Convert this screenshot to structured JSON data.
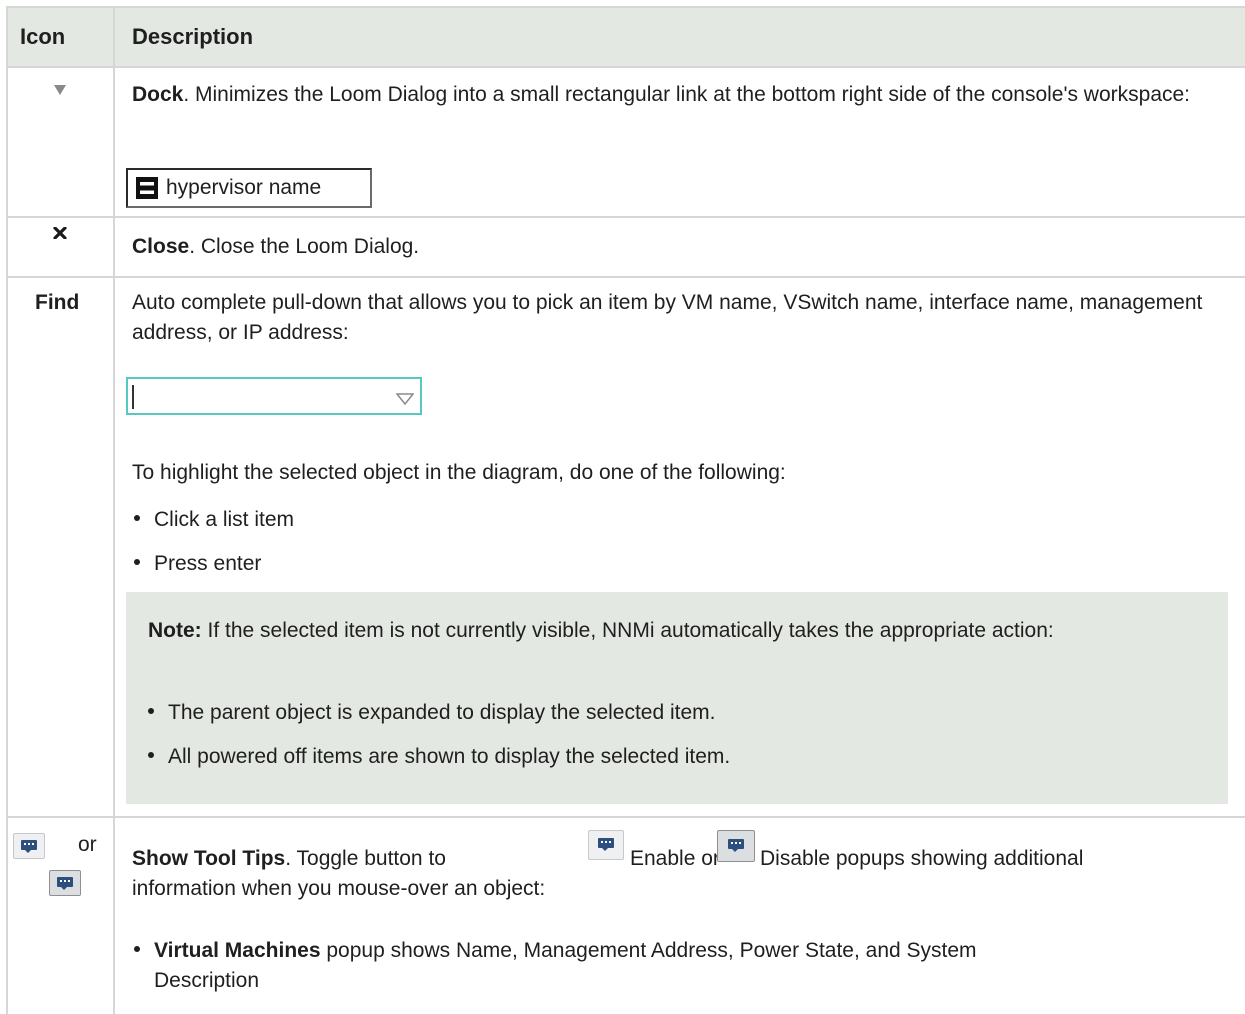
{
  "table": {
    "header": {
      "icon": "Icon",
      "description": "Description"
    },
    "dock": {
      "icon": "dock-triangle-icon",
      "title": "Dock",
      "text": ". Minimizes the Loom Dialog into a small rectangular link at the bottom right side of the console's workspace:",
      "chip_label": "hypervisor name"
    },
    "close": {
      "icon": "close-x-icon",
      "title": "Close",
      "text": ". Close the Loom Dialog."
    },
    "find": {
      "label": "Find",
      "text": "Auto complete pull-down that allows you to pick an item by VM name, VSwitch name, interface name, management address, or IP address:",
      "input_value": "",
      "highlight_intro": "To highlight the selected object in the diagram, do one of the following:",
      "bullets": [
        "Click a list item",
        "Press enter"
      ],
      "note": {
        "label": "Note:",
        "text": " If the selected item is not currently visible, NNMi automatically takes the appropriate action:",
        "bullets": [
          "The parent object is expanded to display the selected item.",
          "All powered off items are shown to display the selected item."
        ]
      }
    },
    "tooltips": {
      "icon_or": "or",
      "title": "Show Tool Tips",
      "text_a": ". Toggle button to ",
      "enable": "Enable or",
      "disable": "Disable popups showing additional",
      "text_b": "information when you mouse-over an object:",
      "bullet_bold": "Virtual Machines",
      "bullet_text": " popup shows Name, Management Address, Power State, and System",
      "bullet_text2": "Description"
    }
  },
  "colors": {
    "header_bg": "#e4e8e2",
    "note_bg": "#e4e8e2",
    "border": "#d6d6d6",
    "input_border": "#57c7c4"
  }
}
